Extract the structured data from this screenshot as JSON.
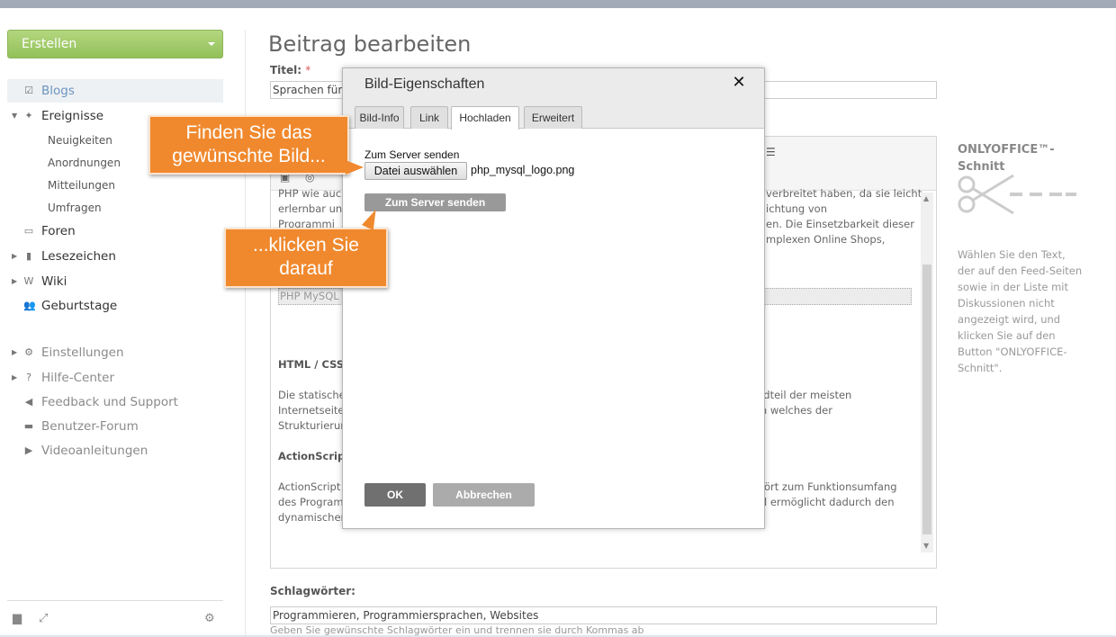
{
  "sidebar": {
    "create_label": "Erstellen",
    "items": [
      {
        "label": "Blogs",
        "icon": "edit-icon"
      },
      {
        "label": "Ereignisse",
        "icon": "pin-icon"
      },
      {
        "label": "Foren",
        "icon": "forum-icon"
      },
      {
        "label": "Lesezeichen",
        "icon": "bookmark-icon"
      },
      {
        "label": "Wiki",
        "icon": "wiki-icon"
      },
      {
        "label": "Geburtstage",
        "icon": "people-icon"
      },
      {
        "label": "Einstellungen",
        "icon": "gear-icon"
      },
      {
        "label": "Hilfe-Center",
        "icon": "help-icon"
      },
      {
        "label": "Feedback und Support",
        "icon": "megaphone-icon"
      },
      {
        "label": "Benutzer-Forum",
        "icon": "chat-icon"
      },
      {
        "label": "Videoanleitungen",
        "icon": "video-icon"
      }
    ],
    "sub_items": [
      "Neuigkeiten",
      "Anordnungen",
      "Mitteilungen",
      "Umfragen"
    ]
  },
  "main": {
    "page_title": "Beitrag bearbeiten",
    "title_label": "Titel:",
    "title_required": "*",
    "title_value": "Sprachen für P",
    "tags_label": "Schlagwörter:",
    "tags_value": "Programmieren, Programmiersprachen, Websites",
    "tags_hint": "Geben Sie gewünschte Schlagwörter ein und trennen sie durch Kommas ab"
  },
  "editor": {
    "para1_lines": [
      {
        "left": "PHP wie auch",
        "right": "verbreitet haben, da sie leicht"
      },
      {
        "left": "erlernbar un",
        "right": "ichtung von"
      },
      {
        "left": "Programmi",
        "right": "en. Die Einsetzbarkeit dieser"
      },
      {
        "left": "",
        "right": "mplexen Online Shops,"
      }
    ],
    "selected_line": "PHP MySQL",
    "heading_html": "HTML / CSS",
    "para2_lines": [
      {
        "left": "Die statische",
        "right": "ndteil der meisten"
      },
      {
        "left": "Internetseite",
        "right": "m welches der"
      },
      {
        "left": "Strukturierur",
        "right": ""
      }
    ],
    "heading_as": "ActionScript",
    "para3_lines": [
      {
        "left": "ActionScript",
        "right": "ört zum Funktionsumfang"
      },
      {
        "left": "des Program",
        "right": "l ermöglicht dadurch den"
      },
      {
        "left": "dynamischer",
        "right": ""
      }
    ]
  },
  "right_panel": {
    "title": "ONLYOFFICE™-Schnitt",
    "description": "Wählen Sie den Text, der auf den Feed-Seiten sowie in der Liste mit Diskussionen nicht angezeigt wird, und klicken Sie auf den Button \"ONLYOFFICE-Schnitt\"."
  },
  "dialog": {
    "title": "Bild-Eigenschaften",
    "close_symbol": "✕",
    "tabs": [
      "Bild-Info",
      "Link",
      "Hochladen",
      "Erweitert"
    ],
    "active_tab": "Hochladen",
    "upload_label": "Zum Server senden",
    "choose_file_label": "Datei auswählen",
    "file_name": "php_mysql_logo.png",
    "send_button": "Zum Server senden",
    "ok_button": "OK",
    "cancel_button": "Abbrechen"
  },
  "callouts": {
    "first": {
      "line1": "Finden Sie das",
      "line2": "gewünschte Bild..."
    },
    "second": {
      "line1": "...klicken Sie",
      "line2": "darauf"
    }
  },
  "colors": {
    "accent_green": "#93c15a",
    "callout_orange": "#f0892e",
    "active_link": "#6b93c0"
  }
}
